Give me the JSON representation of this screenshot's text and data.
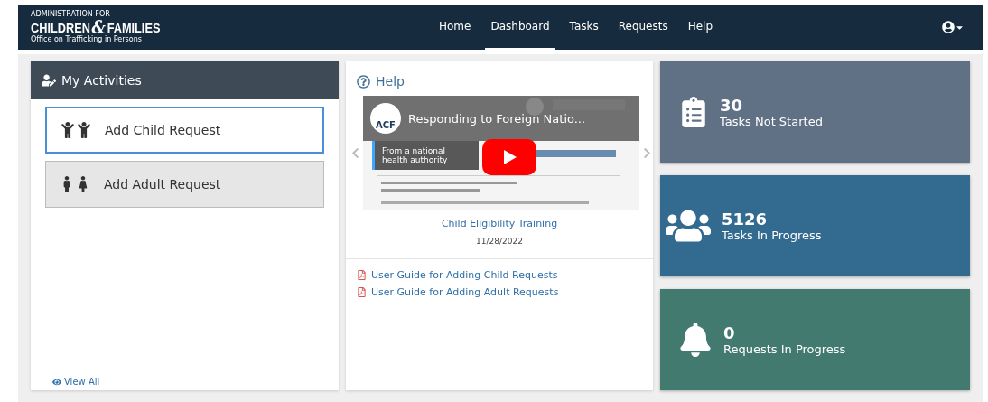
{
  "logo": {
    "top_line": "ADMINISTRATION FOR",
    "main": "CHILDREN",
    "amp": "&",
    "main_end": "FAMILIES",
    "subtitle": "Office on Trafficking in Persons"
  },
  "nav": [
    {
      "label": "Home",
      "selected": false
    },
    {
      "label": "Dashboard",
      "selected": true
    },
    {
      "label": "Tasks",
      "selected": false
    },
    {
      "label": "Requests",
      "selected": false
    },
    {
      "label": "Help",
      "selected": false
    }
  ],
  "activities": {
    "title": "My Activities",
    "items": [
      {
        "label": "Add Child Request",
        "kind": "child",
        "selected": true
      },
      {
        "label": "Add Adult Request",
        "kind": "adult",
        "selected": false
      }
    ],
    "view_all": "View All"
  },
  "help": {
    "title": "Help",
    "video": {
      "channel_badge": "ACF",
      "title": "Responding to Foreign Natio...",
      "info": "From a national health authority"
    },
    "caption": "Child Eligibility Training",
    "date": "11/28/2022",
    "guides": [
      "User Guide for Adding Child Requests",
      "User Guide for Adding Adult Requests"
    ]
  },
  "stats": [
    {
      "value": "30",
      "label": "Tasks Not Started",
      "kind": "clipboard",
      "color": "#607186"
    },
    {
      "value": "5126",
      "label": "Tasks In Progress",
      "kind": "users",
      "color": "#336a90"
    },
    {
      "value": "0",
      "label": "Requests In Progress",
      "kind": "bell",
      "color": "#427a70"
    }
  ]
}
